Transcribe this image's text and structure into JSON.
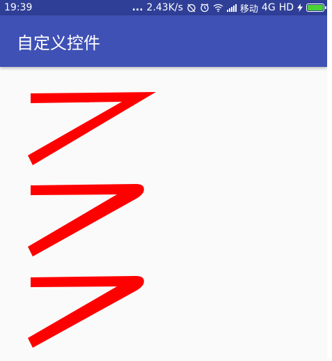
{
  "status_bar": {
    "time": "19:39",
    "dots": "...",
    "speed": "2.43K/s",
    "carrier": "移动",
    "network": "4G",
    "hd": "HD",
    "icons": [
      "alarm-off-icon",
      "alarm-clock-icon",
      "wifi-icon",
      "signal-icon",
      "charging-icon",
      "battery-icon"
    ],
    "battery_level": 1.0,
    "background_color": "#2f3f97"
  },
  "app_bar": {
    "title": "自定义控件",
    "background_color": "#3f51b5"
  },
  "content": {
    "shape_color": "#ff0000",
    "shapes": [
      {
        "name": "sharp-corner-stroke",
        "corner": "sharp"
      },
      {
        "name": "round-corner-stroke",
        "corner": "round"
      },
      {
        "name": "round-corner-stroke-2",
        "corner": "round"
      }
    ]
  }
}
